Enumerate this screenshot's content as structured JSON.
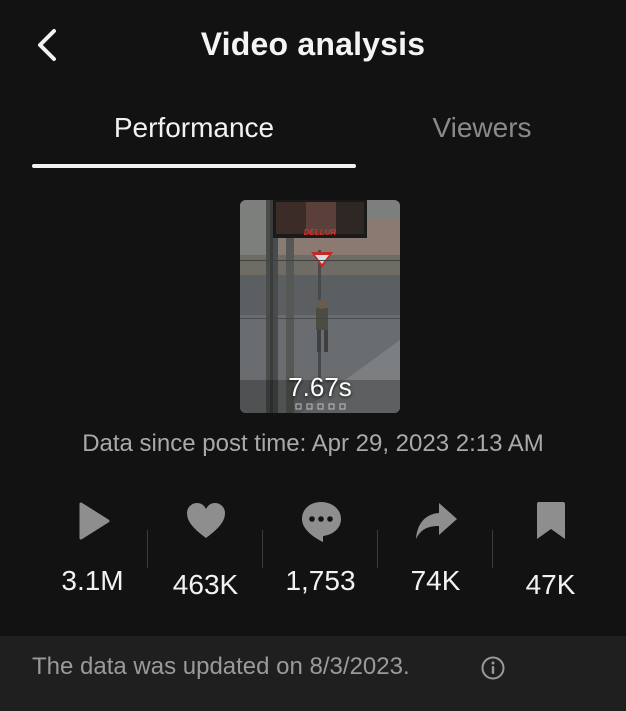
{
  "header": {
    "title": "Video analysis",
    "back_icon": "chevron-left-icon"
  },
  "tabs": [
    {
      "label": "Performance",
      "active": true
    },
    {
      "label": "Viewers",
      "active": false
    }
  ],
  "video": {
    "duration": "7.67s",
    "overlay_text": "DELLUR"
  },
  "data_since": "Data since post time: Apr 29, 2023 2:13 AM",
  "stats": [
    {
      "icon": "play-icon",
      "value": "3.1M"
    },
    {
      "icon": "heart-icon",
      "value": "463K"
    },
    {
      "icon": "comment-icon",
      "value": "1,753"
    },
    {
      "icon": "share-icon",
      "value": "74K"
    },
    {
      "icon": "bookmark-icon",
      "value": "47K"
    }
  ],
  "footer": {
    "text": "The data was updated on 8/3/2023.",
    "icon": "info-icon"
  },
  "colors": {
    "background": "#121212",
    "footer_background": "#1f1f1f",
    "text_primary": "#f2f2f2",
    "text_muted": "#a9a9a9",
    "icon": "#8e8e8e"
  }
}
